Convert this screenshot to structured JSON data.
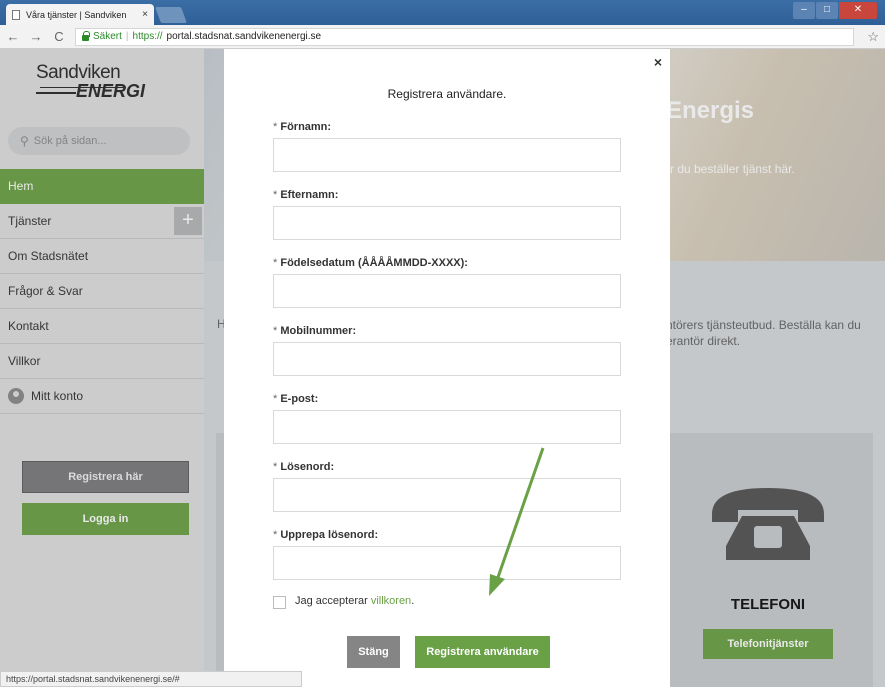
{
  "browser": {
    "tab_title": "Våra tjänster | Sandviken",
    "tab_close": "×",
    "secure_label": "Säkert",
    "url_scheme": "https://",
    "url_host": "portal.stadsnat.sandvikenenergi.se",
    "status_url": "https://portal.stadsnat.sandvikenenergi.se/#"
  },
  "logo": {
    "top": "Sandviken",
    "bottom": "ENERGI"
  },
  "sidebar": {
    "search_placeholder": "Sök på sidan...",
    "items": [
      {
        "label": "Hem",
        "active": true
      },
      {
        "label": "Tjänster",
        "expandable": true
      },
      {
        "label": "Om Stadsnätet"
      },
      {
        "label": "Frågor & Svar"
      },
      {
        "label": "Kontakt"
      },
      {
        "label": "Villkor"
      },
      {
        "label": "Mitt konto",
        "icon": "user-icon"
      }
    ],
    "register_button": "Registrera här",
    "login_button": "Logga in"
  },
  "background": {
    "hero_title": "Energis",
    "hero_subtitle": "r du beställer tjänst här.",
    "intro_letter": "H",
    "intro_text": "ntörers tjänsteutbud. Beställa kan du erantör direkt.",
    "card_title": "TELEFONI",
    "card_button": "Telefonitjänster"
  },
  "modal": {
    "close_glyph": "×",
    "title": "Registrera användare.",
    "required_mark": "*",
    "fields": [
      {
        "label": "Förnamn:",
        "value": ""
      },
      {
        "label": "Efternamn:",
        "value": ""
      },
      {
        "label": "Födelsedatum (ÅÅÅÅMMDD-XXXX):",
        "value": ""
      },
      {
        "label": "Mobilnummer:",
        "value": ""
      },
      {
        "label": "E-post:",
        "value": ""
      },
      {
        "label": "Lösenord:",
        "value": ""
      },
      {
        "label": "Upprepa lösenord:",
        "value": ""
      }
    ],
    "accept_text": "Jag accepterar ",
    "accept_link": "villkoren",
    "accept_end": ".",
    "accept_checked": false,
    "close_button": "Stäng",
    "register_button": "Registrera användare"
  },
  "colors": {
    "accent": "#6aa146",
    "annotation_arrow": "#6aa146"
  }
}
